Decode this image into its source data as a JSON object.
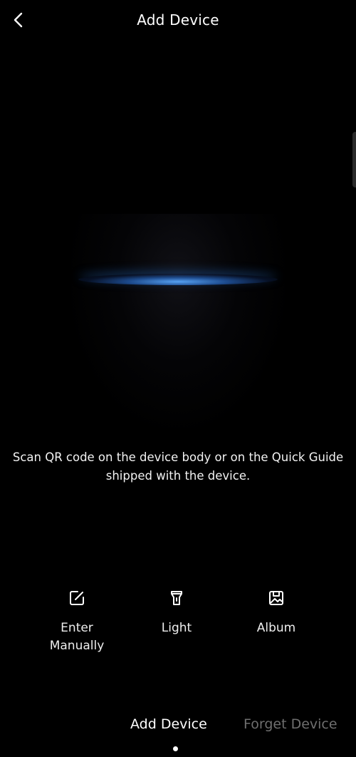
{
  "header": {
    "title": "Add Device",
    "back_icon": "chevron-left-icon"
  },
  "scanner": {
    "hint": "Scan QR code on the device body or on the Quick Guide shipped with the device.",
    "line_color": "#3c8fe6"
  },
  "actions": [
    {
      "label": "Enter\nManually",
      "icon": "edit-icon"
    },
    {
      "label": "Light",
      "icon": "flashlight-icon"
    },
    {
      "label": "Album",
      "icon": "image-icon"
    }
  ],
  "bottom_tabs": {
    "items": [
      {
        "label": "Add Device",
        "active": true
      },
      {
        "label": "Forget Device",
        "active": false
      }
    ]
  },
  "colors": {
    "background": "#000000",
    "text": "#ffffff",
    "inactive_tab": "#6f6f6f"
  }
}
